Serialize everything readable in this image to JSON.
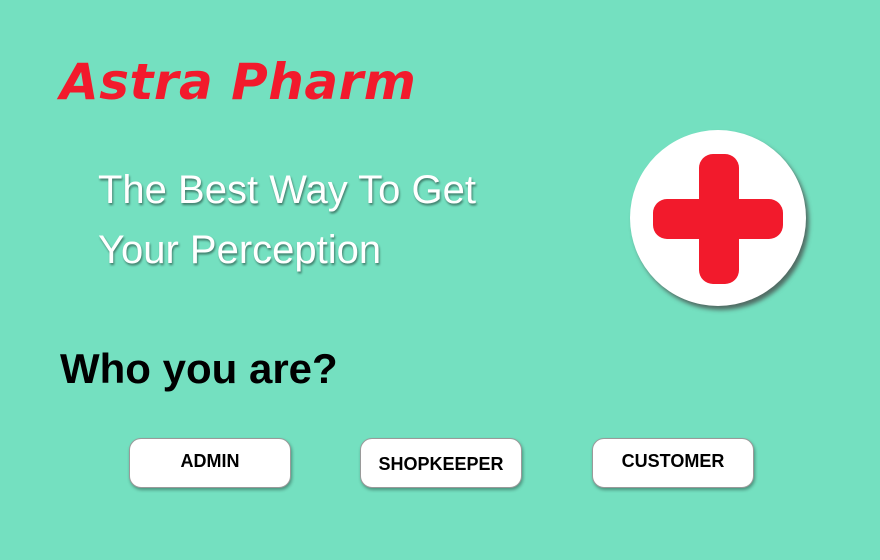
{
  "app": {
    "title": "Astra Pharm"
  },
  "hero": {
    "tagline_line1": "The Best Way To Get",
    "tagline_line2": "Your Perception"
  },
  "logo": {
    "icon": "medical-cross-icon"
  },
  "roles": {
    "question": "Who you are?",
    "buttons": [
      {
        "label": "ADMIN"
      },
      {
        "label": "SHOPKEEPER"
      },
      {
        "label": "CUSTOMER"
      }
    ]
  },
  "colors": {
    "background": "#74E0C0",
    "brand_red": "#F21A2C",
    "tagline_text": "#FFFFFF",
    "button_bg": "#FFFFFF"
  }
}
